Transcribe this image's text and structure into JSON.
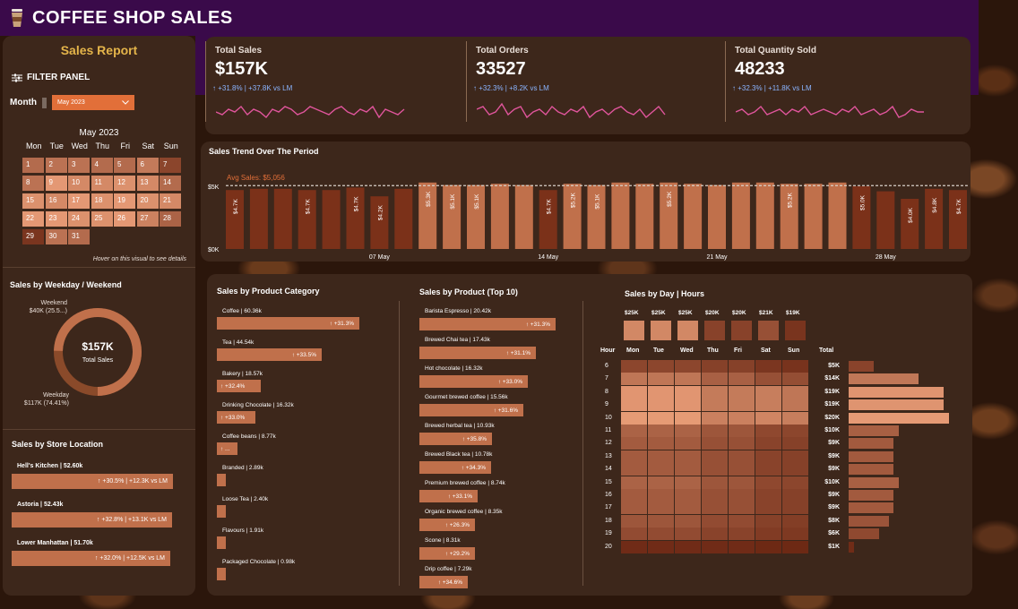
{
  "header": {
    "title": "COFFEE SHOP SALES",
    "cup_icon": "coffee-cup-icon"
  },
  "left": {
    "title": "Sales Report",
    "filter_label": "FILTER PANEL",
    "month_label": "Month",
    "month_value": "May 2023",
    "calendar": {
      "title": "May 2023",
      "weekdays": [
        "Mon",
        "Tue",
        "Wed",
        "Thu",
        "Fri",
        "Sat",
        "Sun"
      ],
      "days": [
        1,
        2,
        3,
        4,
        5,
        6,
        7,
        8,
        9,
        10,
        11,
        12,
        13,
        14,
        15,
        16,
        17,
        18,
        19,
        20,
        21,
        22,
        23,
        24,
        25,
        26,
        27,
        28,
        29,
        30,
        31
      ],
      "hover_note": "Hover on this visual to see details"
    },
    "weekday_weekend": {
      "title": "Sales by Weekday / Weekend",
      "center_value": "$157K",
      "center_label": "Total Sales",
      "weekend_label": "Weekend",
      "weekend_value": "$40K (25.5...)",
      "weekday_label": "Weekday",
      "weekday_value": "$117K (74.41%)",
      "weekday_share": 74.41
    },
    "stores": {
      "title": "Sales by Store Location",
      "items": [
        {
          "name": "Hell's Kitchen | 52.60k",
          "delta": "↑ +30.5% | +12.3K vs LM",
          "value": 52.6
        },
        {
          "name": "Astoria | 52.43k",
          "delta": "↑ +32.8% | +13.1K vs LM",
          "value": 52.43
        },
        {
          "name": "Lower Manhattan | 51.70k",
          "delta": "↑ +32.0% | +12.5K vs LM",
          "value": 51.7
        }
      ]
    }
  },
  "kpis": [
    {
      "title": "Total Sales",
      "value": "$157K",
      "delta": "↑ +31.8% | +37.8K vs LM"
    },
    {
      "title": "Total Orders",
      "value": "33527",
      "delta": "↑ +32.3% | +8.2K vs LM"
    },
    {
      "title": "Total Quantity Sold",
      "value": "48233",
      "delta": "↑ +32.3% | +11.8K vs LM"
    }
  ],
  "colors": {
    "accent": "#c0704b",
    "spark": "#e0559c",
    "purple": "#3a0a4a",
    "delta": "#8ab4ff"
  },
  "trend": {
    "title": "Sales Trend Over The Period",
    "avg_label": "Avg Sales: $5,056",
    "y_ticks": [
      "$5K",
      "$0K"
    ],
    "x_ticks": [
      "07 May",
      "14 May",
      "21 May",
      "28 May"
    ]
  },
  "chart_data": {
    "type": "bar",
    "title": "Sales Trend Over The Period",
    "categories": [
      "1",
      "2",
      "3",
      "4",
      "5",
      "6",
      "7",
      "8",
      "9",
      "10",
      "11",
      "12",
      "13",
      "14",
      "15",
      "16",
      "17",
      "18",
      "19",
      "20",
      "21",
      "22",
      "23",
      "24",
      "25",
      "26",
      "27",
      "28",
      "29",
      "30",
      "31"
    ],
    "values": [
      4.7,
      4.8,
      4.8,
      4.7,
      4.7,
      4.9,
      4.2,
      4.8,
      5.3,
      5.1,
      5.1,
      5.2,
      5.1,
      4.7,
      5.2,
      5.1,
      5.3,
      5.2,
      5.3,
      5.2,
      5.1,
      5.3,
      5.3,
      5.2,
      5.2,
      5.3,
      5.0,
      4.6,
      4.0,
      4.8,
      4.7
    ],
    "labels": [
      "$4.7K",
      "",
      "",
      "$4.7K",
      "",
      "$4.7K",
      "$4.2K",
      "",
      "$5.3K",
      "$5.1K",
      "$5.1K",
      "",
      "",
      "$4.7K",
      "$5.2K",
      "$5.1K",
      "",
      "",
      "$5.2K",
      "",
      "",
      "",
      "",
      "$5.2K",
      "",
      "",
      "$5.0K",
      "",
      "$4.0K",
      "$4.8K",
      "$4.7K"
    ],
    "avg": 5.056,
    "ylim": [
      0,
      5.5
    ],
    "ylabel": "",
    "xlabel": ""
  },
  "category": {
    "title": "Sales by Product Category",
    "items": [
      {
        "name": "Coffee | 60.36k",
        "delta": "↑ +31.3%",
        "value": 60.36
      },
      {
        "name": "Tea | 44.54k",
        "delta": "↑ +33.5%",
        "value": 44.54
      },
      {
        "name": "Bakery | 18.57k",
        "delta": "↑ +32.4%",
        "value": 18.57
      },
      {
        "name": "Drinking Chocolate | 16.32k",
        "delta": "↑ +33.0%",
        "value": 16.32
      },
      {
        "name": "Coffee beans | 8.77k",
        "delta": "↑ ...",
        "value": 8.77
      },
      {
        "name": "Branded | 2.89k",
        "delta": "",
        "value": 2.89
      },
      {
        "name": "Loose Tea | 2.40k",
        "delta": "",
        "value": 2.4
      },
      {
        "name": "Flavours | 1.91k",
        "delta": "",
        "value": 1.91
      },
      {
        "name": "Packaged Chocolate | 0.98k",
        "delta": "",
        "value": 0.98
      }
    ]
  },
  "products": {
    "title": "Sales by Product (Top 10)",
    "items": [
      {
        "name": "Barista Espresso | 20.42k",
        "delta": "↑ +31.3%",
        "value": 20.42
      },
      {
        "name": "Brewed Chai tea | 17.43k",
        "delta": "↑ +31.1%",
        "value": 17.43
      },
      {
        "name": "Hot chocolate | 16.32k",
        "delta": "↑ +33.0%",
        "value": 16.32
      },
      {
        "name": "Gourmet brewed coffee | 15.56k",
        "delta": "↑ +31.6%",
        "value": 15.56
      },
      {
        "name": "Brewed herbal tea | 10.93k",
        "delta": "↑ +35.8%",
        "value": 10.93
      },
      {
        "name": "Brewed Black tea | 10.78k",
        "delta": "↑ +34.3%",
        "value": 10.78
      },
      {
        "name": "Premium brewed coffee | 8.74k",
        "delta": "↑ +33.1%",
        "value": 8.74
      },
      {
        "name": "Organic brewed coffee | 8.35k",
        "delta": "↑ +26.3%",
        "value": 8.35
      },
      {
        "name": "Scone | 8.31k",
        "delta": "↑ +29.2%",
        "value": 8.31
      },
      {
        "name": "Drip coffee | 7.29k",
        "delta": "↑ +34.6%",
        "value": 7.29
      }
    ]
  },
  "heatmap": {
    "title": "Sales by Day | Hours",
    "hour_label": "Hour",
    "total_label": "Total",
    "days": [
      "Mon",
      "Tue",
      "Wed",
      "Thu",
      "Fri",
      "Sat",
      "Sun"
    ],
    "day_totals": [
      "$25K",
      "$25K",
      "$25K",
      "$20K",
      "$20K",
      "$21K",
      "$19K"
    ],
    "day_values": [
      25,
      25,
      25,
      20,
      20,
      21,
      19
    ],
    "hours": [
      "6",
      "7",
      "8",
      "9",
      "10",
      "11",
      "12",
      "13",
      "14",
      "15",
      "16",
      "17",
      "18",
      "19",
      "20"
    ],
    "hour_totals": [
      "$5K",
      "$14K",
      "$19K",
      "$19K",
      "$20K",
      "$10K",
      "$9K",
      "$9K",
      "$9K",
      "$10K",
      "$9K",
      "$9K",
      "$8K",
      "$6K",
      "$1K"
    ],
    "hour_values": [
      5,
      14,
      19,
      19,
      20,
      10,
      9,
      9,
      9,
      10,
      9,
      9,
      8,
      6,
      1
    ],
    "grid": [
      [
        1.2,
        1.2,
        1.2,
        1.0,
        1.0,
        0.6,
        0.5
      ],
      [
        3.0,
        3.0,
        3.0,
        2.2,
        2.2,
        1.6,
        1.5
      ],
      [
        4.2,
        4.2,
        4.2,
        3.2,
        3.2,
        3.3,
        3.0
      ],
      [
        4.2,
        4.2,
        4.2,
        3.2,
        3.2,
        3.3,
        3.0
      ],
      [
        4.4,
        4.4,
        4.4,
        3.4,
        3.4,
        3.6,
        3.3
      ],
      [
        2.3,
        2.3,
        2.3,
        1.8,
        1.8,
        1.3,
        1.2
      ],
      [
        2.0,
        2.0,
        2.0,
        1.6,
        1.6,
        1.1,
        1.0
      ],
      [
        2.0,
        2.0,
        2.0,
        1.6,
        1.6,
        1.1,
        1.0
      ],
      [
        2.0,
        2.0,
        2.0,
        1.6,
        1.6,
        1.1,
        1.0
      ],
      [
        2.3,
        2.3,
        2.3,
        1.8,
        1.8,
        1.3,
        1.2
      ],
      [
        2.0,
        2.0,
        2.0,
        1.6,
        1.6,
        1.1,
        1.0
      ],
      [
        2.0,
        2.0,
        2.0,
        1.6,
        1.6,
        1.1,
        1.0
      ],
      [
        1.8,
        1.8,
        1.8,
        1.4,
        1.4,
        1.0,
        0.9
      ],
      [
        1.4,
        1.4,
        1.4,
        1.1,
        1.1,
        0.8,
        0.7
      ],
      [
        0.2,
        0.2,
        0.2,
        0.2,
        0.2,
        0.1,
        0.1
      ]
    ]
  }
}
